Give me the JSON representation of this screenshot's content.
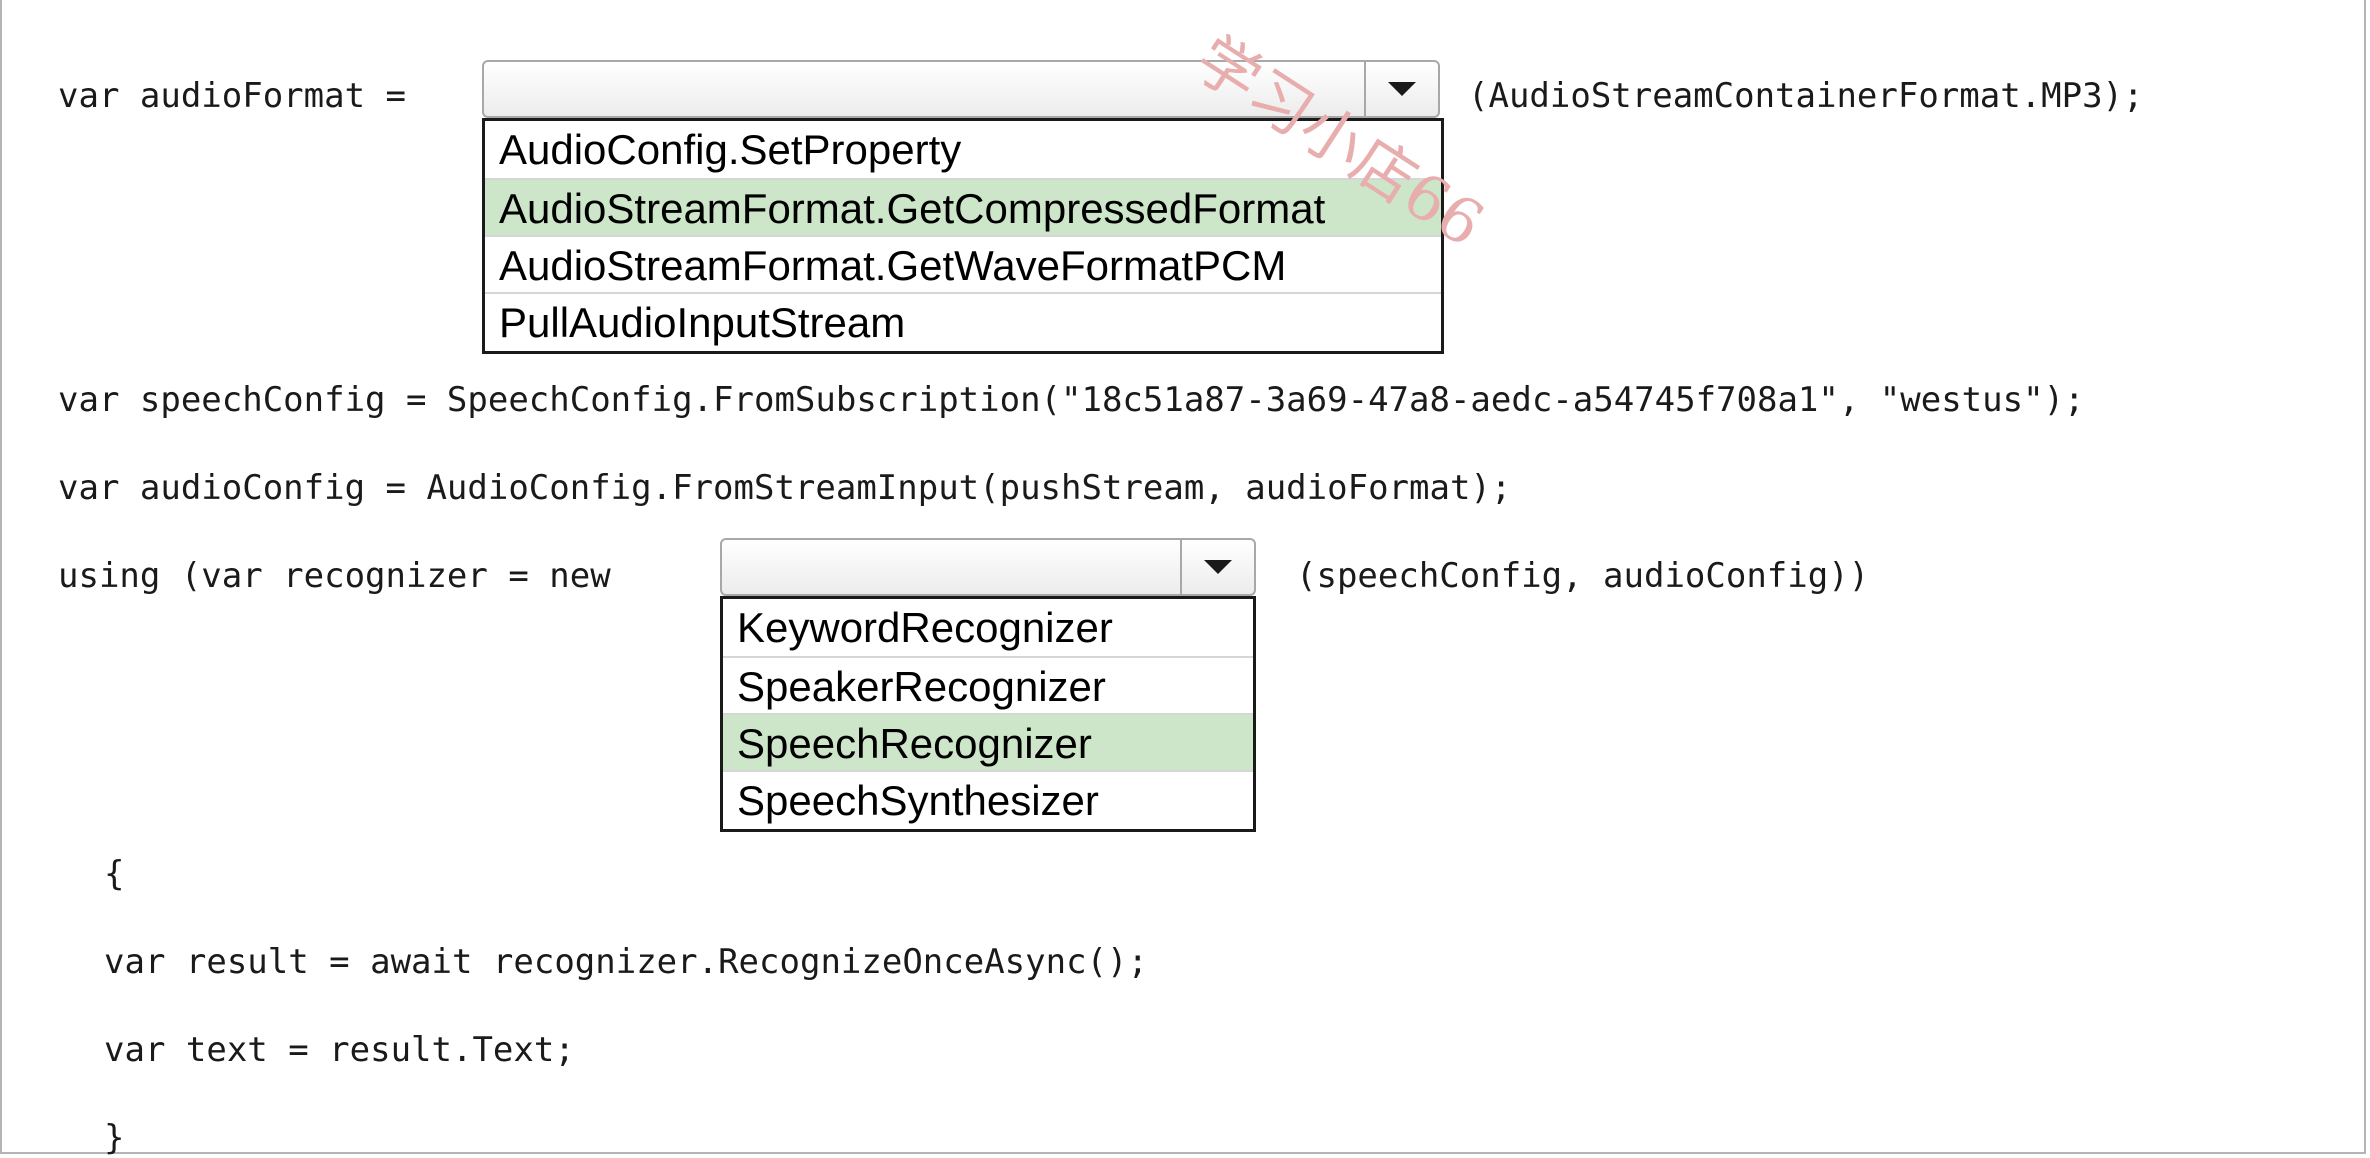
{
  "lines": {
    "audio_format_prefix": "var audioFormat =",
    "audio_format_suffix": "(AudioStreamContainerFormat.MP3);",
    "speech_config": "var speechConfig = SpeechConfig.FromSubscription(\"18c51a87-3a69-47a8-aedc-a54745f708a1\", \"westus\");",
    "audio_config": "var audioConfig = AudioConfig.FromStreamInput(pushStream, audioFormat);",
    "recognizer_prefix": "using (var recognizer = new",
    "recognizer_suffix": "(speechConfig, audioConfig))",
    "open_brace": "{",
    "result": "var result = await recognizer.RecognizeOnceAsync();",
    "text": "var text = result.Text;",
    "close_brace": "}"
  },
  "dropdown1": {
    "value": "",
    "options": [
      "AudioConfig.SetProperty",
      "AudioStreamFormat.GetCompressedFormat",
      "AudioStreamFormat.GetWaveFormatPCM",
      "PullAudioInputStream"
    ],
    "selected_index": 1
  },
  "dropdown2": {
    "value": "",
    "options": [
      "KeywordRecognizer",
      "SpeakerRecognizer",
      "SpeechRecognizer",
      "SpeechSynthesizer"
    ],
    "selected_index": 2
  },
  "watermark": "学习小店66",
  "colors": {
    "highlight": "#cde6c9",
    "watermark": "#e8adad"
  }
}
